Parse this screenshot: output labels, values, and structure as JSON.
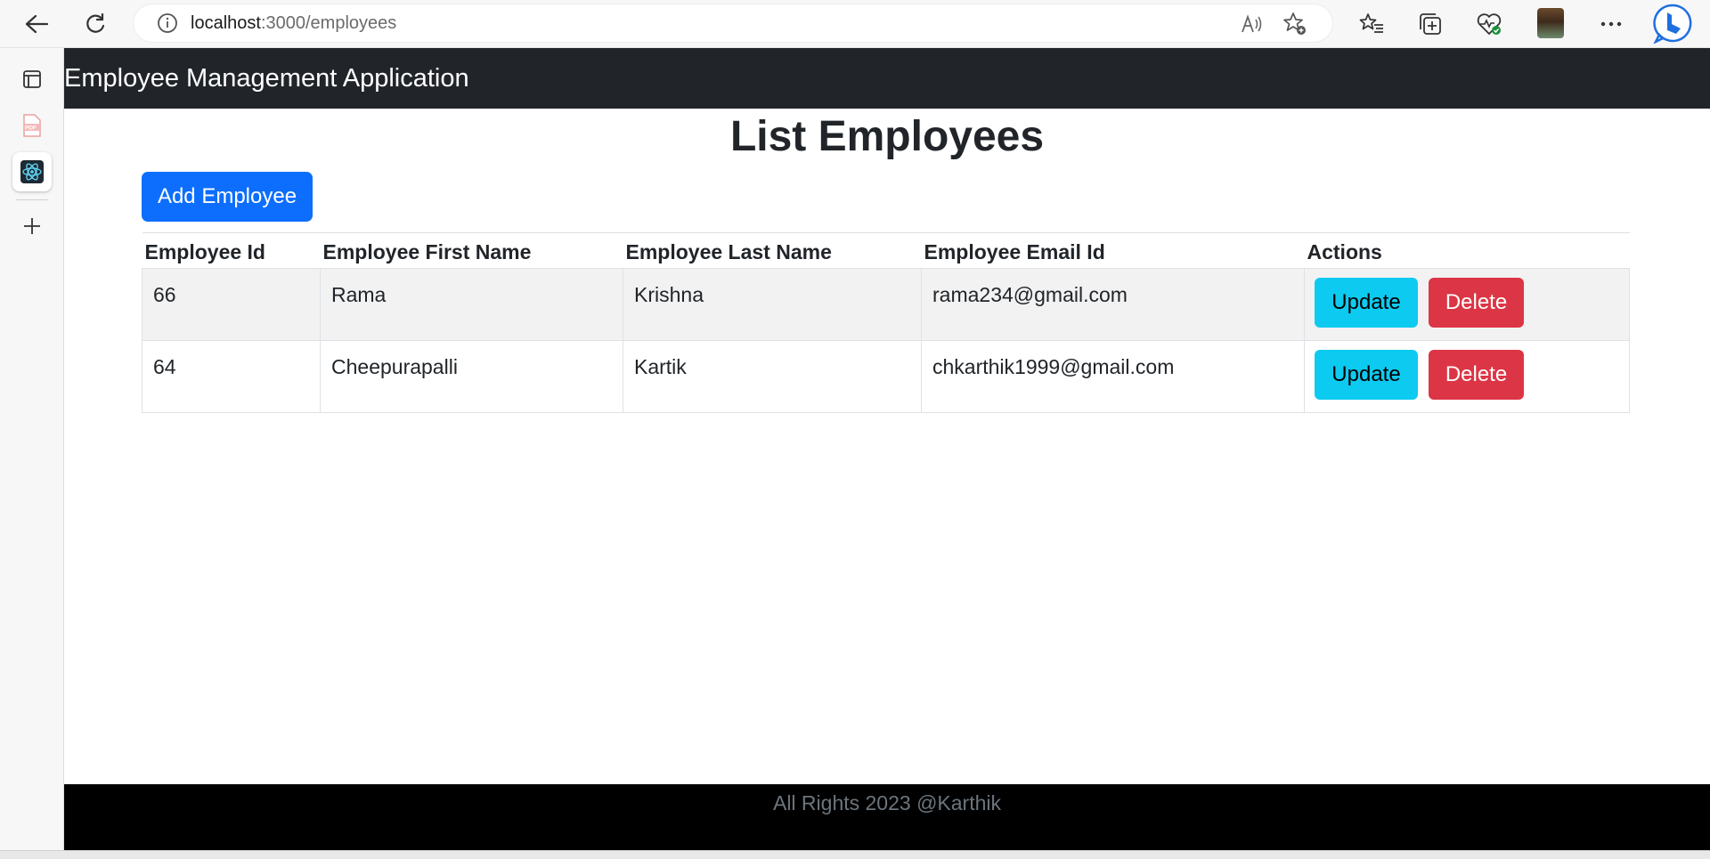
{
  "browser": {
    "url_host": "localhost",
    "url_path": ":3000/employees"
  },
  "app": {
    "brand": "Employee Management Application",
    "page_title": "List Employees",
    "add_button": "Add Employee",
    "table": {
      "headers": [
        "Employee Id",
        "Employee First Name",
        "Employee Last Name",
        "Employee Email Id",
        "Actions"
      ],
      "rows": [
        {
          "id": "66",
          "first_name": "Rama",
          "last_name": "Krishna",
          "email": "rama234@gmail.com"
        },
        {
          "id": "64",
          "first_name": "Cheepurapalli",
          "last_name": "Kartik",
          "email": "chkarthik1999@gmail.com"
        }
      ],
      "update_label": "Update",
      "delete_label": "Delete"
    },
    "footer": "All Rights 2023 @Karthik"
  },
  "colors": {
    "navbar": "#212529",
    "primary": "#0d6efd",
    "info": "#0dcaf0",
    "danger": "#dc3545"
  }
}
